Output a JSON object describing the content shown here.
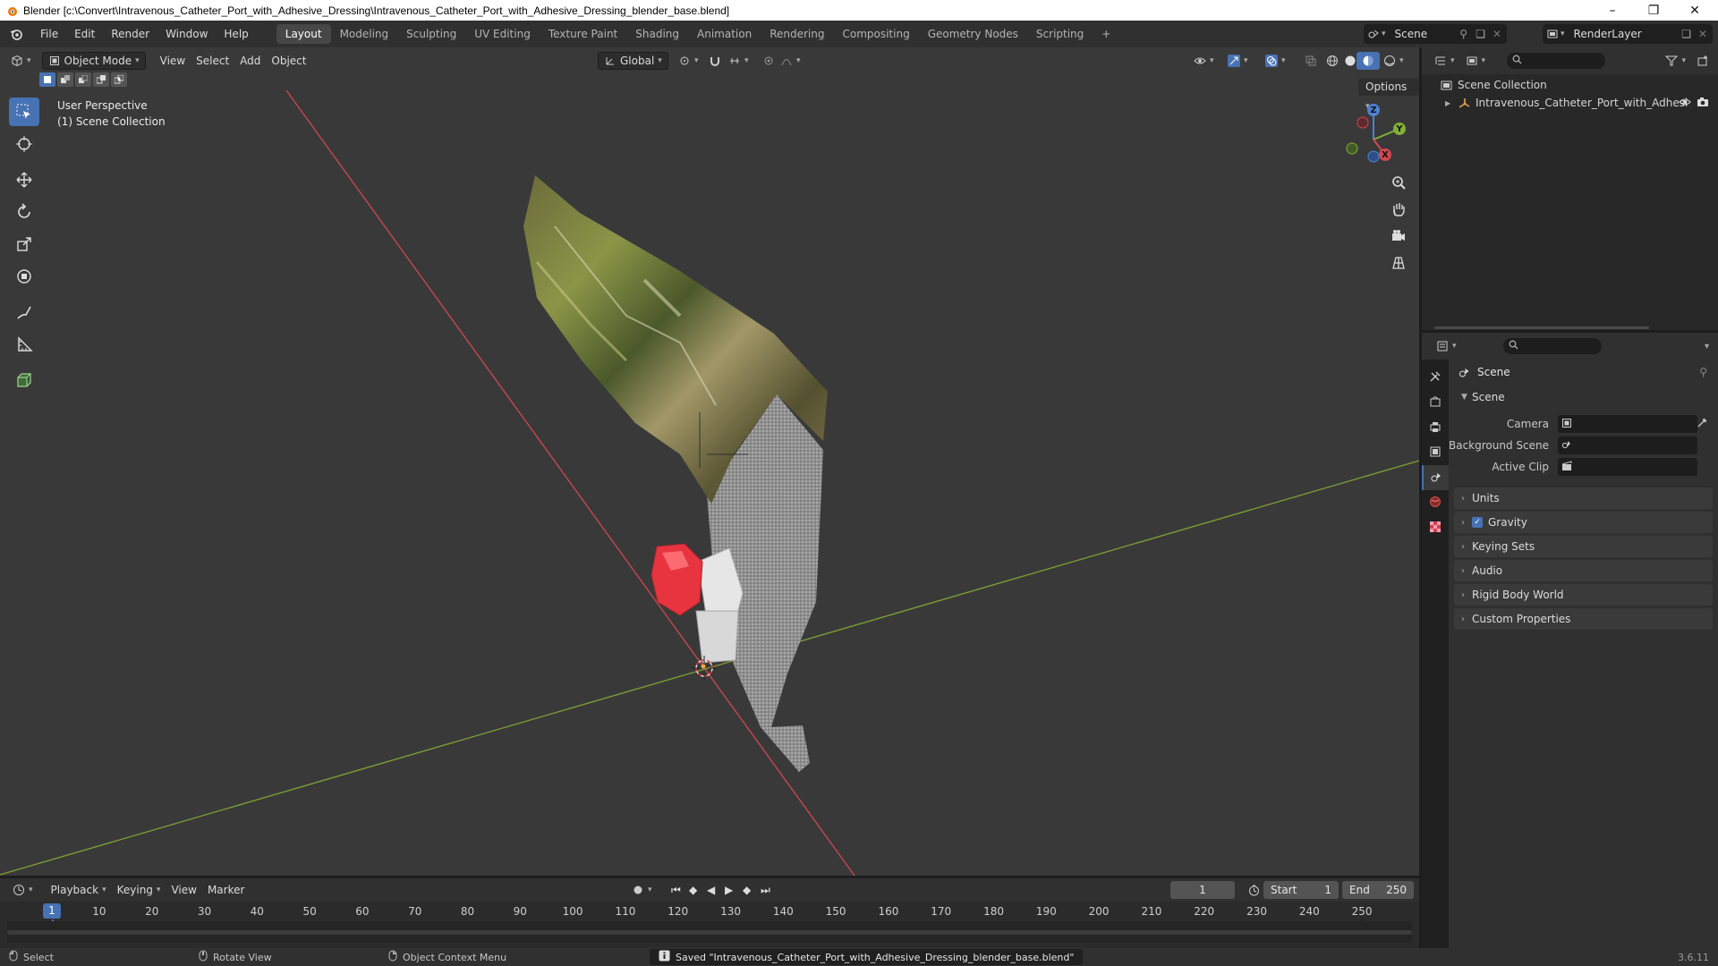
{
  "window": {
    "title": "Blender [c:\\Convert\\Intravenous_Catheter_Port_with_Adhesive_Dressing\\Intravenous_Catheter_Port_with_Adhesive_Dressing_blender_base.blend]"
  },
  "menu": {
    "items": [
      "File",
      "Edit",
      "Render",
      "Window",
      "Help"
    ]
  },
  "workspaces": {
    "tabs": [
      "Layout",
      "Modeling",
      "Sculpting",
      "UV Editing",
      "Texture Paint",
      "Shading",
      "Animation",
      "Rendering",
      "Compositing",
      "Geometry Nodes",
      "Scripting"
    ],
    "active": "Layout",
    "add_label": "+"
  },
  "scene_selector": {
    "value": "Scene"
  },
  "view_layer_selector": {
    "value": "RenderLayer"
  },
  "viewport": {
    "mode": "Object Mode",
    "menus": [
      "View",
      "Select",
      "Add",
      "Object"
    ],
    "transform_orientation": "Global",
    "options_label": "Options",
    "overlay_lines": [
      "User Perspective",
      "(1) Scene Collection"
    ],
    "gizmo_axes": {
      "x": "X",
      "y": "Y",
      "z": "Z"
    },
    "colors": {
      "background": "#393939",
      "x_axis": "#d2474f",
      "y_axis": "#7fa23a",
      "active_tool": "#4772b3"
    }
  },
  "outliner": {
    "root": "Scene Collection",
    "items": [
      {
        "label": "Intravenous_Catheter_Port_with_Adhesi"
      }
    ]
  },
  "properties": {
    "context_title": "Scene",
    "section": "Scene",
    "rows": [
      {
        "label": "Camera",
        "value": ""
      },
      {
        "label": "Background Scene",
        "value": ""
      },
      {
        "label": "Active Clip",
        "value": ""
      }
    ],
    "panels": [
      {
        "label": "Units",
        "checkbox": false
      },
      {
        "label": "Gravity",
        "checkbox": true
      },
      {
        "label": "Keying Sets",
        "checkbox": false
      },
      {
        "label": "Audio",
        "checkbox": false
      },
      {
        "label": "Rigid Body World",
        "checkbox": false
      },
      {
        "label": "Custom Properties",
        "checkbox": false
      }
    ]
  },
  "timeline": {
    "menus": [
      "Playback",
      "Keying",
      "View",
      "Marker"
    ],
    "current_frame": "1",
    "start_label": "Start",
    "start_value": "1",
    "end_label": "End",
    "end_value": "250",
    "ticks": [
      "1",
      "10",
      "20",
      "30",
      "40",
      "50",
      "60",
      "70",
      "80",
      "90",
      "100",
      "110",
      "120",
      "130",
      "140",
      "150",
      "160",
      "170",
      "180",
      "190",
      "200",
      "210",
      "220",
      "230",
      "240",
      "250"
    ]
  },
  "statusbar": {
    "select": "Select",
    "rotate": "Rotate View",
    "context_menu": "Object Context Menu",
    "message": "Saved \"Intravenous_Catheter_Port_with_Adhesive_Dressing_blender_base.blend\"",
    "version": "3.6.11"
  }
}
